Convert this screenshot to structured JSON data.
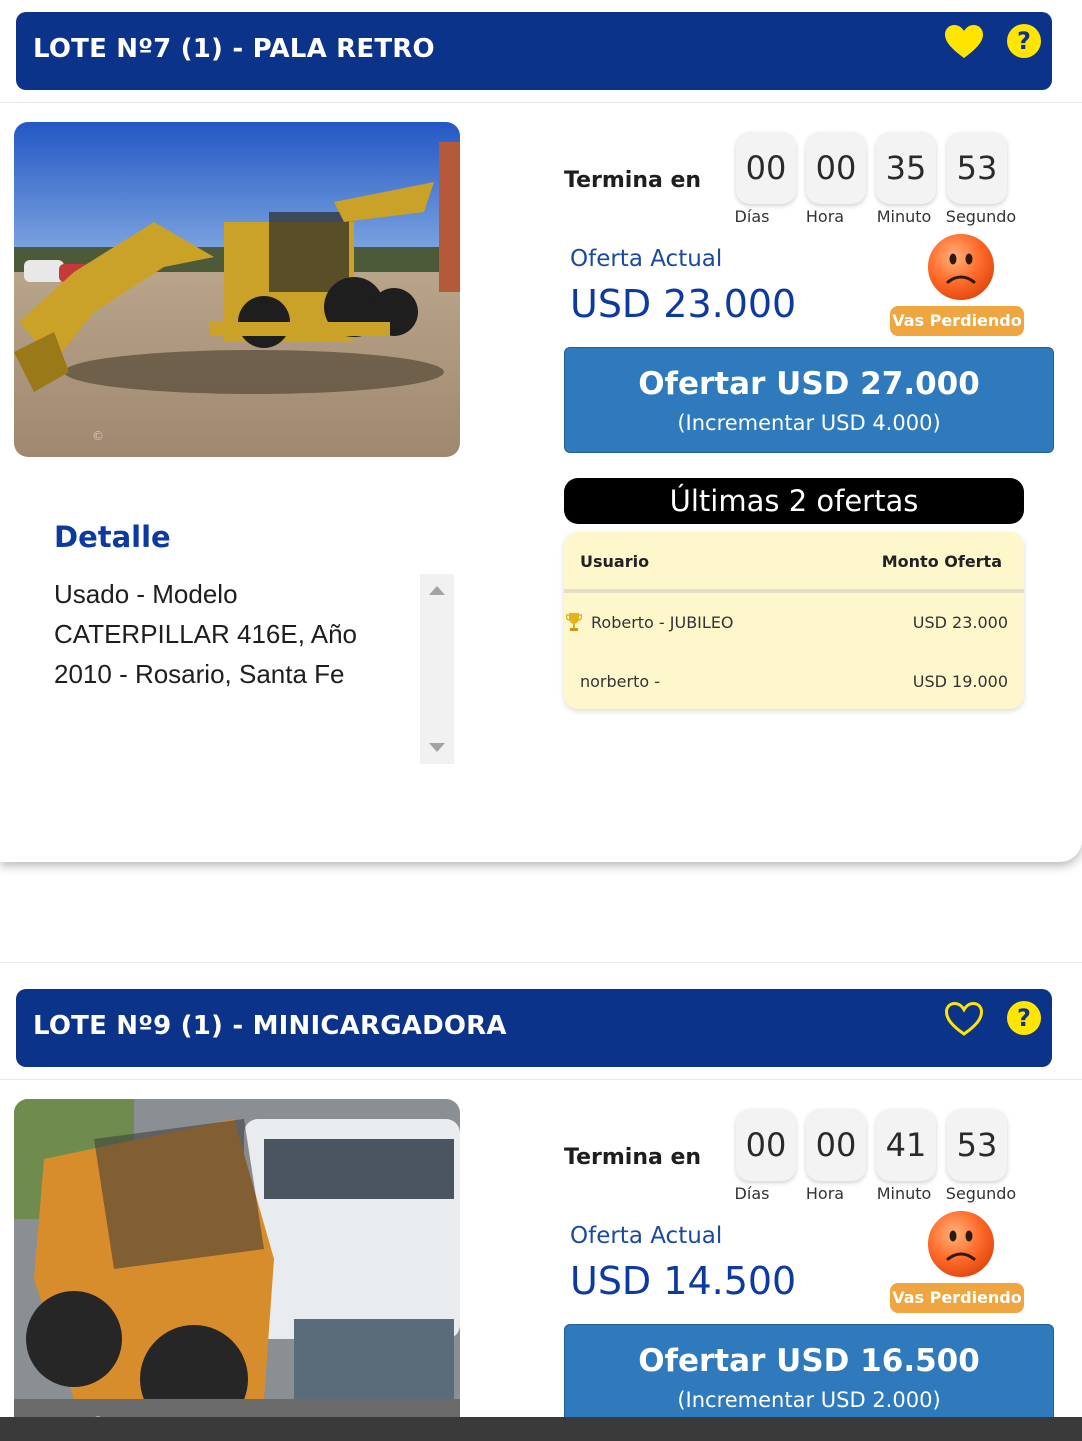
{
  "colors": {
    "header_bg": "#0b3389",
    "heart_yellow": "#ffe500",
    "bid_button": "#2f79bd",
    "losing_badge": "#f0a640",
    "table_bg": "#fff7cc"
  },
  "lots": [
    {
      "title": "LOTE Nº7 (1) - PALA RETRO",
      "favorite_icon": "heart-filled-icon",
      "favorited": true,
      "help_symbol": "?",
      "photo_mark": "©",
      "ends_label": "Termina en",
      "countdown": [
        {
          "value": "00",
          "label": "Días"
        },
        {
          "value": "00",
          "label": "Hora"
        },
        {
          "value": "35",
          "label": "Minuto"
        },
        {
          "value": "53",
          "label": "Segundo"
        }
      ],
      "current_offer_label": "Oferta Actual",
      "current_offer_value": "USD 23.000",
      "status_icon": "sad-face-icon",
      "status_badge": "Vas Perdiendo",
      "bid_button_main": "Ofertar USD 27.000",
      "bid_button_sub": "(Incrementar USD 4.000)",
      "last_offers_title": "Últimas 2 ofertas",
      "offers_table": {
        "headers": [
          "Usuario",
          "Monto Oferta"
        ],
        "rows": [
          {
            "user": "Roberto - JUBILEO",
            "amount": "USD 23.000",
            "winner_icon": "trophy-icon"
          },
          {
            "user": "norberto -",
            "amount": "USD 19.000"
          }
        ]
      },
      "detail_title": "Detalle",
      "detail_text": "Usado - Modelo CATERPILLAR 416E, Año 2010 - Rosario, Santa Fe"
    },
    {
      "title": "LOTE Nº9 (1) - MINICARGADORA",
      "favorite_icon": "heart-outline-icon",
      "favorited": false,
      "help_symbol": "?",
      "photo_mark": "©",
      "ends_label": "Termina en",
      "countdown": [
        {
          "value": "00",
          "label": "Días"
        },
        {
          "value": "00",
          "label": "Hora"
        },
        {
          "value": "41",
          "label": "Minuto"
        },
        {
          "value": "53",
          "label": "Segundo"
        }
      ],
      "current_offer_label": "Oferta Actual",
      "current_offer_value": "USD 14.500",
      "status_icon": "sad-face-icon",
      "status_badge": "Vas Perdiendo",
      "bid_button_main": "Ofertar USD 16.500",
      "bid_button_sub": "(Incrementar USD 2.000)"
    }
  ]
}
